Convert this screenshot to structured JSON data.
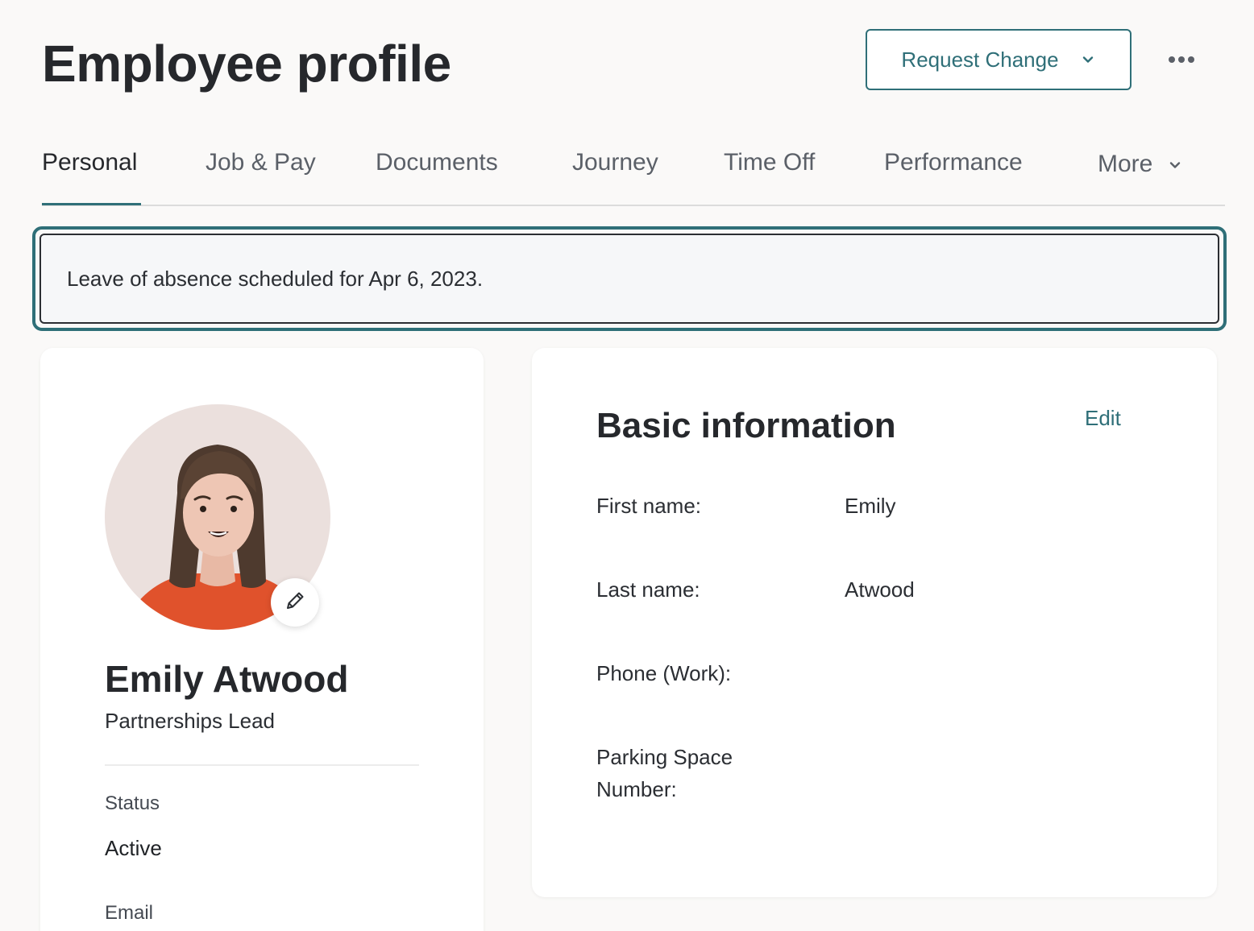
{
  "header": {
    "title": "Employee profile",
    "request_change_label": "Request Change"
  },
  "tabs": [
    {
      "label": "Personal"
    },
    {
      "label": "Job & Pay"
    },
    {
      "label": "Documents"
    },
    {
      "label": "Journey"
    },
    {
      "label": "Time Off"
    },
    {
      "label": "Performance"
    },
    {
      "label": "More"
    }
  ],
  "alert": {
    "message": "Leave of absence scheduled for Apr 6, 2023."
  },
  "profile": {
    "name": "Emily Atwood",
    "role": "Partnerships Lead",
    "status_label": "Status",
    "status_value": "Active",
    "email_label": "Email"
  },
  "basic_info": {
    "title": "Basic information",
    "edit_label": "Edit",
    "fields": [
      {
        "label": "First name:",
        "value": "Emily"
      },
      {
        "label": "Last name:",
        "value": "Atwood"
      },
      {
        "label": "Phone (Work):",
        "value": ""
      },
      {
        "label": "Parking Space Number:",
        "value": ""
      }
    ]
  },
  "colors": {
    "accent": "#2f6f78",
    "background": "#faf9f8",
    "avatar_bg": "#ebe0dd",
    "shirt": "#e0522c"
  },
  "icons": {
    "request_chevron": "chevron-down-icon",
    "more_menu": "more-horizontal-icon",
    "tab_more_chevron": "chevron-down-icon",
    "edit_photo": "pencil-icon"
  }
}
